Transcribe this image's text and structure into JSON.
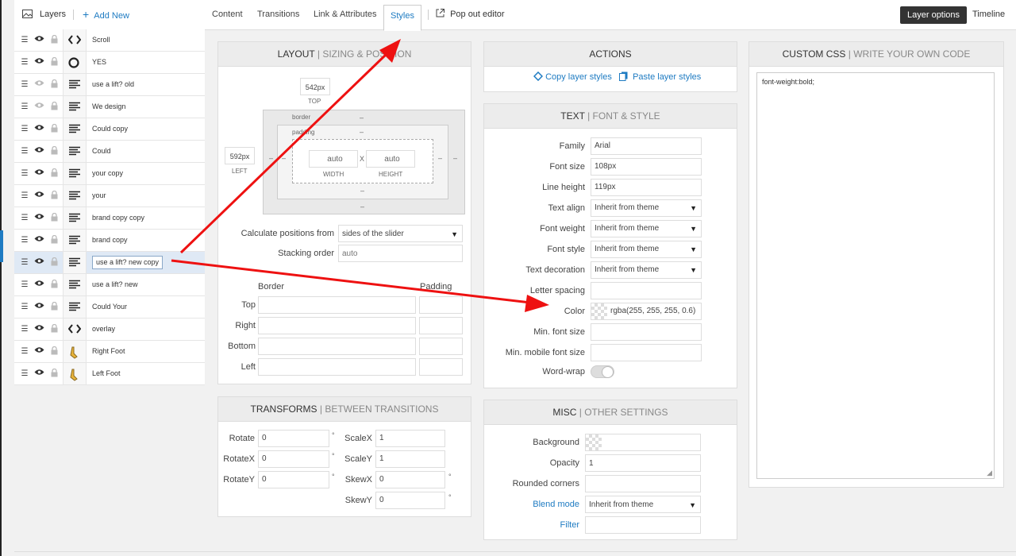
{
  "topbar": {
    "layers_label": "Layers",
    "add_new_label": "Add New",
    "tabs": [
      {
        "label": "Content",
        "active": false
      },
      {
        "label": "Transitions",
        "active": false
      },
      {
        "label": "Link & Attributes",
        "active": false
      },
      {
        "label": "Styles",
        "active": true
      }
    ],
    "pop_out_label": "Pop out editor",
    "layer_options_label": "Layer options",
    "timeline_label": "Timeline"
  },
  "layers": [
    {
      "name": "Scroll",
      "type": "code-icon",
      "visible": true
    },
    {
      "name": "YES",
      "type": "circle-icon",
      "visible": true
    },
    {
      "name": "use a lift? old",
      "type": "text-icon",
      "visible": false
    },
    {
      "name": "We design",
      "type": "text-icon",
      "visible": false
    },
    {
      "name": "Could copy",
      "type": "text-icon",
      "visible": true
    },
    {
      "name": "Could",
      "type": "text-icon",
      "visible": true
    },
    {
      "name": "your copy",
      "type": "text-icon",
      "visible": true
    },
    {
      "name": "your",
      "type": "text-icon",
      "visible": true
    },
    {
      "name": "brand copy copy",
      "type": "text-icon",
      "visible": true
    },
    {
      "name": "brand copy",
      "type": "text-icon",
      "visible": true
    },
    {
      "name": "use a lift? new copy",
      "type": "text-icon",
      "visible": true,
      "selected": true
    },
    {
      "name": "use a lift? new",
      "type": "text-icon",
      "visible": true
    },
    {
      "name": "Could Your",
      "type": "text-icon",
      "visible": true
    },
    {
      "name": "overlay",
      "type": "code-icon",
      "visible": true
    },
    {
      "name": "Right Foot",
      "type": "image-icon",
      "visible": true
    },
    {
      "name": "Left Foot",
      "type": "image-icon",
      "visible": true
    }
  ],
  "layout": {
    "title": "LAYOUT",
    "subtitle": "SIZING & POSITION",
    "top_value": "542px",
    "top_label": "TOP",
    "left_value": "592px",
    "left_label": "LEFT",
    "border_label": "border",
    "padding_label": "padding",
    "dash": "–",
    "width_value": "auto",
    "width_label": "WIDTH",
    "height_value": "auto",
    "height_label": "HEIGHT",
    "times": "X",
    "calc_label": "Calculate positions from",
    "calc_value": "sides of the slider",
    "stacking_label": "Stacking order",
    "stacking_placeholder": "auto",
    "border_head": "Border",
    "padding_head": "Padding",
    "sides": [
      "Top",
      "Right",
      "Bottom",
      "Left"
    ]
  },
  "actions": {
    "title": "ACTIONS",
    "copy_label": "Copy layer styles",
    "paste_label": "Paste layer styles"
  },
  "text": {
    "title": "TEXT",
    "subtitle": "FONT & STYLE",
    "fields": [
      {
        "label": "Family",
        "value": "Arial",
        "select": false
      },
      {
        "label": "Font size",
        "value": "108px",
        "select": false
      },
      {
        "label": "Line height",
        "value": "119px",
        "select": false
      },
      {
        "label": "Text align",
        "value": "Inherit from theme",
        "select": true
      },
      {
        "label": "Font weight",
        "value": "Inherit from theme",
        "select": true
      },
      {
        "label": "Font style",
        "value": "Inherit from theme",
        "select": true
      },
      {
        "label": "Text decoration",
        "value": "Inherit from theme",
        "select": true
      },
      {
        "label": "Letter spacing",
        "value": "",
        "select": false
      },
      {
        "label": "Color",
        "value": "rgba(255, 255, 255, 0.6)",
        "select": false,
        "swatch": true
      },
      {
        "label": "Min. font size",
        "value": "",
        "select": false
      },
      {
        "label": "Min. mobile font size",
        "value": "",
        "select": false
      }
    ],
    "wordwrap_label": "Word-wrap"
  },
  "transforms": {
    "title": "TRANSFORMS",
    "subtitle": "BETWEEN TRANSITIONS",
    "degree": "°",
    "left": [
      {
        "label": "Rotate",
        "value": "0"
      },
      {
        "label": "RotateX",
        "value": "0"
      },
      {
        "label": "RotateY",
        "value": "0"
      }
    ],
    "right": [
      {
        "label": "ScaleX",
        "value": "1",
        "unit": ""
      },
      {
        "label": "ScaleY",
        "value": "1",
        "unit": ""
      },
      {
        "label": "SkewX",
        "value": "0",
        "unit": "°"
      },
      {
        "label": "SkewY",
        "value": "0",
        "unit": "°"
      }
    ]
  },
  "misc": {
    "title": "MISC",
    "subtitle": "OTHER SETTINGS",
    "background_label": "Background",
    "opacity_label": "Opacity",
    "opacity_value": "1",
    "rounded_label": "Rounded corners",
    "blend_label": "Blend mode",
    "blend_value": "Inherit from theme",
    "filter_label": "Filter"
  },
  "css": {
    "title": "CUSTOM CSS",
    "subtitle": "WRITE YOUR OWN CODE",
    "code": "font-weight:bold;"
  },
  "colors": {
    "accent": "#1e7bc2",
    "arrow": "#ee1111",
    "selected_row": "#dfe9f5"
  }
}
